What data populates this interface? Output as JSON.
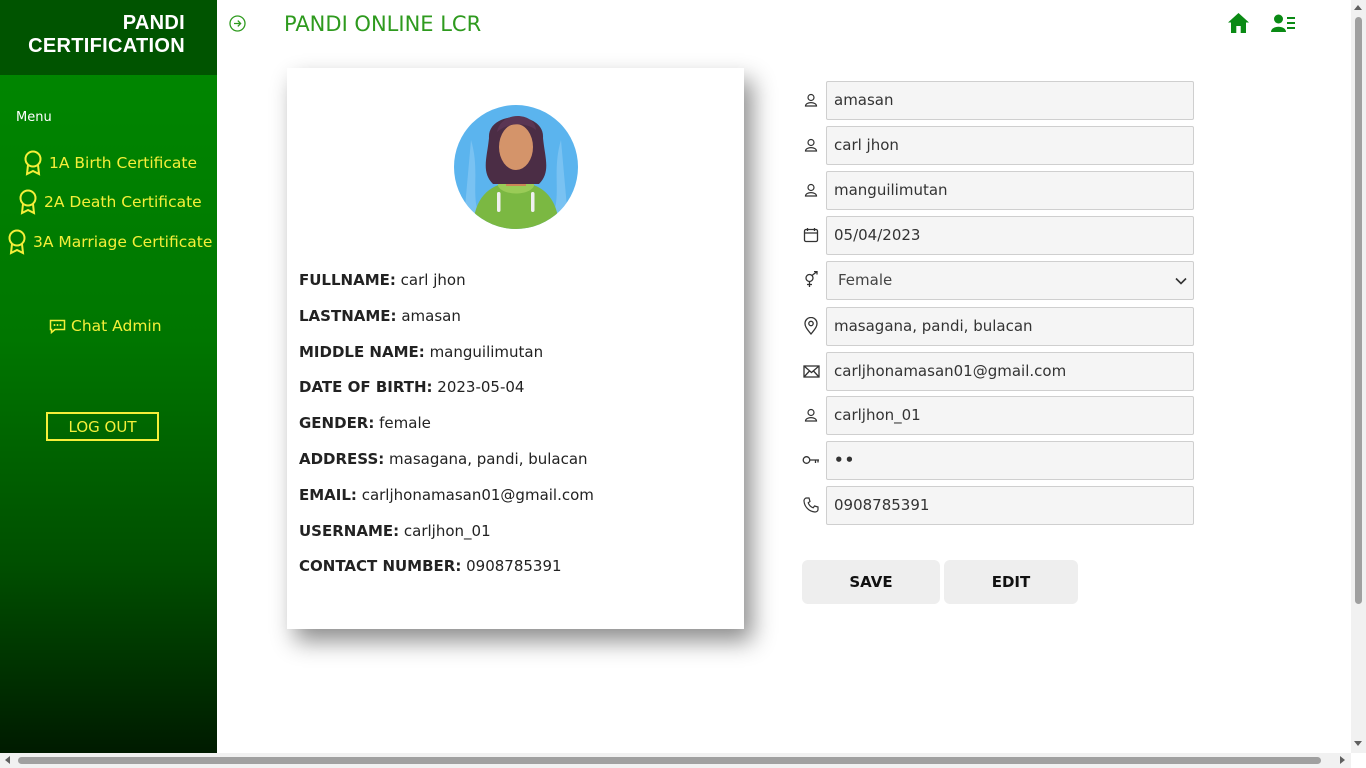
{
  "sidebar": {
    "brand_line1": "PANDI",
    "brand_line2": "CERTIFICATION",
    "menu_title": "Menu",
    "items": [
      {
        "label": "1A Birth Certificate",
        "icon": "award-icon"
      },
      {
        "label": "2A Death Certificate",
        "icon": "award-icon"
      },
      {
        "label": "3A Marriage Certificate",
        "icon": "award-icon"
      }
    ],
    "chat_label": "Chat Admin",
    "logout_label": "LOG OUT"
  },
  "header": {
    "title": "PANDI ONLINE LCR",
    "icons": [
      "arrow-right-circle-icon",
      "home-icon",
      "user-list-icon"
    ]
  },
  "profile": {
    "rows": [
      {
        "label": "FULLNAME:",
        "value": "carl jhon"
      },
      {
        "label": "LASTNAME:",
        "value": "amasan"
      },
      {
        "label": "MIDDLE NAME:",
        "value": "manguilimutan"
      },
      {
        "label": "DATE OF BIRTH:",
        "value": "2023-05-04"
      },
      {
        "label": "GENDER:",
        "value": "female"
      },
      {
        "label": "ADDRESS:",
        "value": "masagana, pandi, bulacan"
      },
      {
        "label": "EMAIL:",
        "value": "carljhonamasan01@gmail.com"
      },
      {
        "label": "USERNAME:",
        "value": "carljhon_01"
      },
      {
        "label": "CONTACT NUMBER:",
        "value": "0908785391"
      }
    ]
  },
  "form": {
    "lastname": "amasan",
    "firstname": "carl jhon",
    "middlename": "manguilimutan",
    "birthdate": "05/04/2023",
    "gender_selected": "Female",
    "address": "masagana, pandi, bulacan",
    "email": "carljhonamasan01@gmail.com",
    "username": "carljhon_01",
    "password_mask": "••",
    "contact": "0908785391",
    "save_label": "SAVE",
    "edit_label": "EDIT"
  },
  "colors": {
    "sidebar_top": "#008a00",
    "sidebar_bottom": "#001b00",
    "brand_bg": "#005400",
    "menu_text": "#f5ef3a",
    "title_green": "#2e9a1e",
    "icon_green": "#0a8a14"
  }
}
